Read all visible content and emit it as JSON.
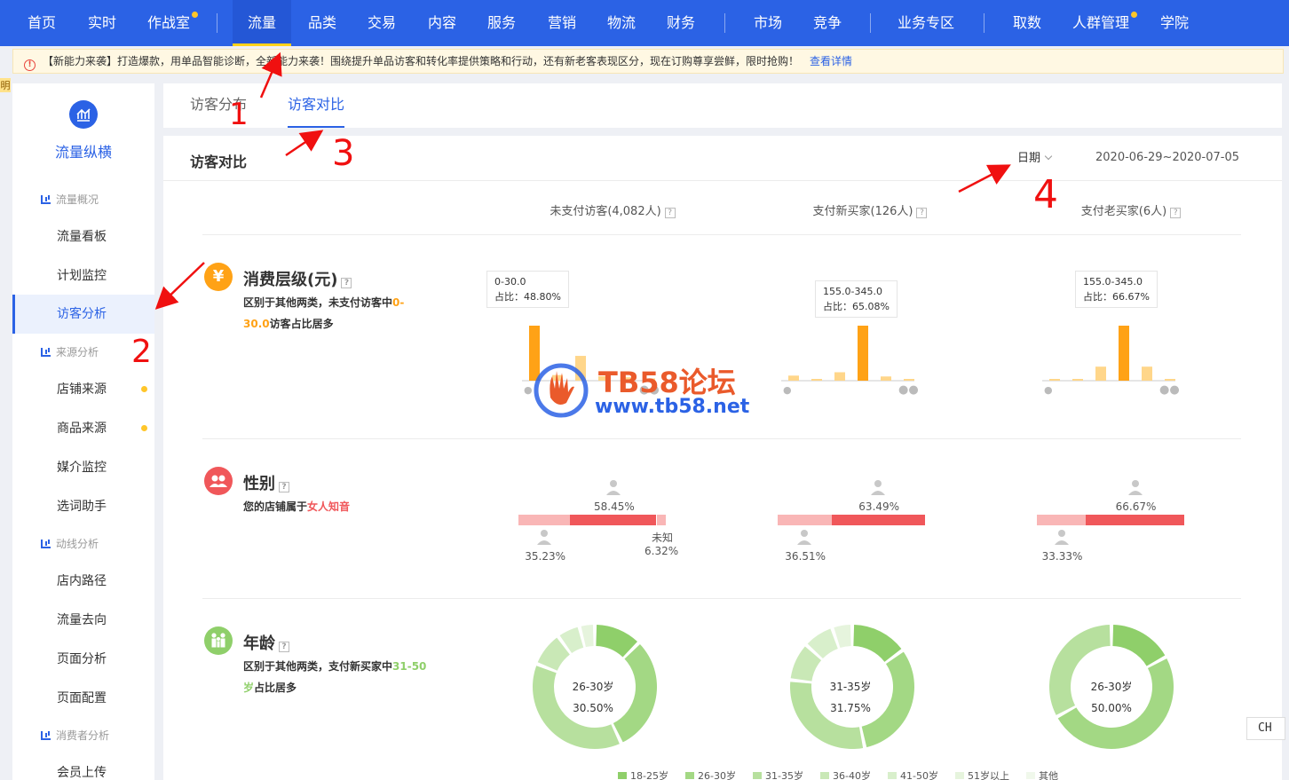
{
  "nav": {
    "items": [
      "首页",
      "实时",
      "作战室",
      "流量",
      "品类",
      "交易",
      "内容",
      "服务",
      "营销",
      "物流",
      "财务",
      "市场",
      "竞争",
      "业务专区",
      "取数",
      "人群管理",
      "学院"
    ],
    "active": "流量"
  },
  "notice": {
    "text": "【新能力来袭】打造爆款，用单品智能诊断，全新能力来袭！围绕提升单品访客和转化率提供策略和行动，还有新老客表现区分，现在订购尊享尝鲜，限时抢购！",
    "link": "查看详情"
  },
  "edge_char": "明",
  "sidebar": {
    "title": "流量纵横",
    "groups": [
      {
        "head": "流量概况",
        "items": [
          "流量看板",
          "计划监控",
          "访客分析"
        ]
      },
      {
        "head": "来源分析",
        "items": [
          "店铺来源",
          "商品来源",
          "媒介监控",
          "选词助手"
        ]
      },
      {
        "head": "动线分析",
        "items": [
          "店内路径",
          "流量去向",
          "页面分析",
          "页面配置"
        ]
      },
      {
        "head": "消费者分析",
        "items": [
          "会员上传"
        ]
      }
    ],
    "active": "访客分析"
  },
  "tabs": [
    "访客分布",
    "访客对比"
  ],
  "active_tab": "访客对比",
  "card": {
    "title": "访客对比",
    "date_label": "日期",
    "date_range": "2020-06-29~2020-07-05"
  },
  "columns": [
    "未支付访客(4,082人)",
    "支付新买家(126人)",
    "支付老买家(6人)"
  ],
  "consumption": {
    "title": "消费层级(元)",
    "desc_pre": "区别于其他两类，未支付访客中",
    "desc_hl": "0-30.0",
    "desc_post": "访客占比居多",
    "tooltips": [
      {
        "range": "0-30.0",
        "ratio": "占比：48.80%"
      },
      {
        "range": "155.0-345.0",
        "ratio": "占比：65.08%"
      },
      {
        "range": "155.0-345.0",
        "ratio": "占比：66.67%"
      }
    ],
    "bars": [
      [
        0.488,
        0.05,
        0.22,
        0.04,
        0.03,
        0.02
      ],
      [
        0.06,
        0.02,
        0.1,
        0.6508,
        0.05,
        0.01
      ],
      [
        0.01,
        0.01,
        0.17,
        0.6667,
        0.17,
        0.01
      ]
    ],
    "highlight_index": [
      0,
      3,
      3
    ]
  },
  "gender": {
    "title": "性别",
    "desc_pre": "您的店铺属于",
    "desc_hl": "女人知音",
    "cols": [
      {
        "female": "58.45%",
        "male": "35.23%",
        "unknown_label": "未知",
        "unknown": "6.32%",
        "male_frac": 0.3523,
        "female_frac": 0.5845,
        "unknown_frac": 0.0632
      },
      {
        "female": "63.49%",
        "male": "36.51%",
        "male_frac": 0.3651,
        "female_frac": 0.6349
      },
      {
        "female": "66.67%",
        "male": "33.33%",
        "male_frac": 0.3333,
        "female_frac": 0.6667
      }
    ]
  },
  "age": {
    "title": "年龄",
    "desc_pre": "区别于其他两类，支付新买家中",
    "desc_hl": "31-50岁",
    "desc_post": "占比居多",
    "donuts": [
      {
        "label": "26-30岁",
        "value": "30.50%",
        "slices": [
          0.125,
          0.305,
          0.38,
          0.09,
          0.06,
          0.04
        ]
      },
      {
        "label": "31-35岁",
        "value": "31.75%",
        "slices": [
          0.15,
          0.3175,
          0.3,
          0.1,
          0.08,
          0.0525
        ]
      },
      {
        "label": "26-30岁",
        "value": "50.00%",
        "slices": [
          0.17,
          0.5,
          0.33
        ]
      }
    ],
    "legend": [
      "18-25岁",
      "26-30岁",
      "31-35岁",
      "36-40岁",
      "41-50岁",
      "51岁以上",
      "其他"
    ]
  },
  "watermark": {
    "t1": "TB58论坛",
    "t2": "www.tb58.net"
  },
  "ch_badge": "CH",
  "annotations": [
    "1",
    "2",
    "3",
    "4"
  ],
  "colors": {
    "primary": "#2b62e5",
    "orange": "#ffa216",
    "orange_light": "#ffd68a",
    "red": "#f0575a",
    "green": "#8fcf6a"
  }
}
